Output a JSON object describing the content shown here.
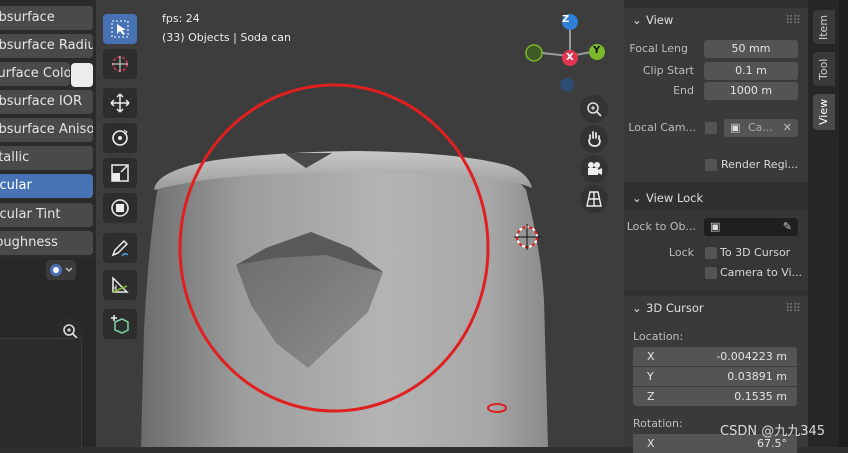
{
  "left_panel": {
    "properties": [
      {
        "label": "Subsurface",
        "selected": false
      },
      {
        "label": "Subsurface Radius",
        "selected": false
      },
      {
        "label": "Subsurface Color",
        "selected": false
      },
      {
        "label": "Subsurface IOR",
        "selected": false
      },
      {
        "label": "Subsurface Anisotropy",
        "selected": false
      },
      {
        "label": "Metallic",
        "selected": false
      },
      {
        "label": "Specular",
        "selected": true
      },
      {
        "label": "Specular Tint",
        "selected": false
      },
      {
        "label": "Roughness",
        "selected": false
      }
    ],
    "swatch_color": "#ececec"
  },
  "viewport": {
    "fps": "fps: 24",
    "objects": "(33) Objects | Soda can",
    "gizmo": {
      "z": "Z",
      "y": "Y",
      "x": "X"
    },
    "highlight_color": "#e02020"
  },
  "npanel": {
    "view": {
      "title": "View",
      "focal_length_label": "Focal Leng",
      "focal_length": "50 mm",
      "clip_start_label": "Clip Start",
      "clip_start": "0.1 m",
      "end_label": "End",
      "clip_end": "1000 m",
      "local_camera_label": "Local Cam...",
      "local_camera_value": "Ca...",
      "render_region_label": "Render Regi..."
    },
    "view_lock": {
      "title": "View Lock",
      "lock_to_object_label": "Lock to Ob...",
      "lock_label": "Lock",
      "to_3d_cursor": "To 3D Cursor",
      "camera_to_view": "Camera to Vi..."
    },
    "cursor": {
      "title": "3D Cursor",
      "location_label": "Location:",
      "x_key": "X",
      "x": "-0.004223 m",
      "y_key": "Y",
      "y": "0.03891 m",
      "z_key": "Z",
      "z": "0.1535 m",
      "rotation_label": "Rotation:",
      "rx_key": "X",
      "rx": "67.5°"
    }
  },
  "tabs": [
    "Item",
    "Tool",
    "View"
  ],
  "watermark": "CSDN @九九345"
}
